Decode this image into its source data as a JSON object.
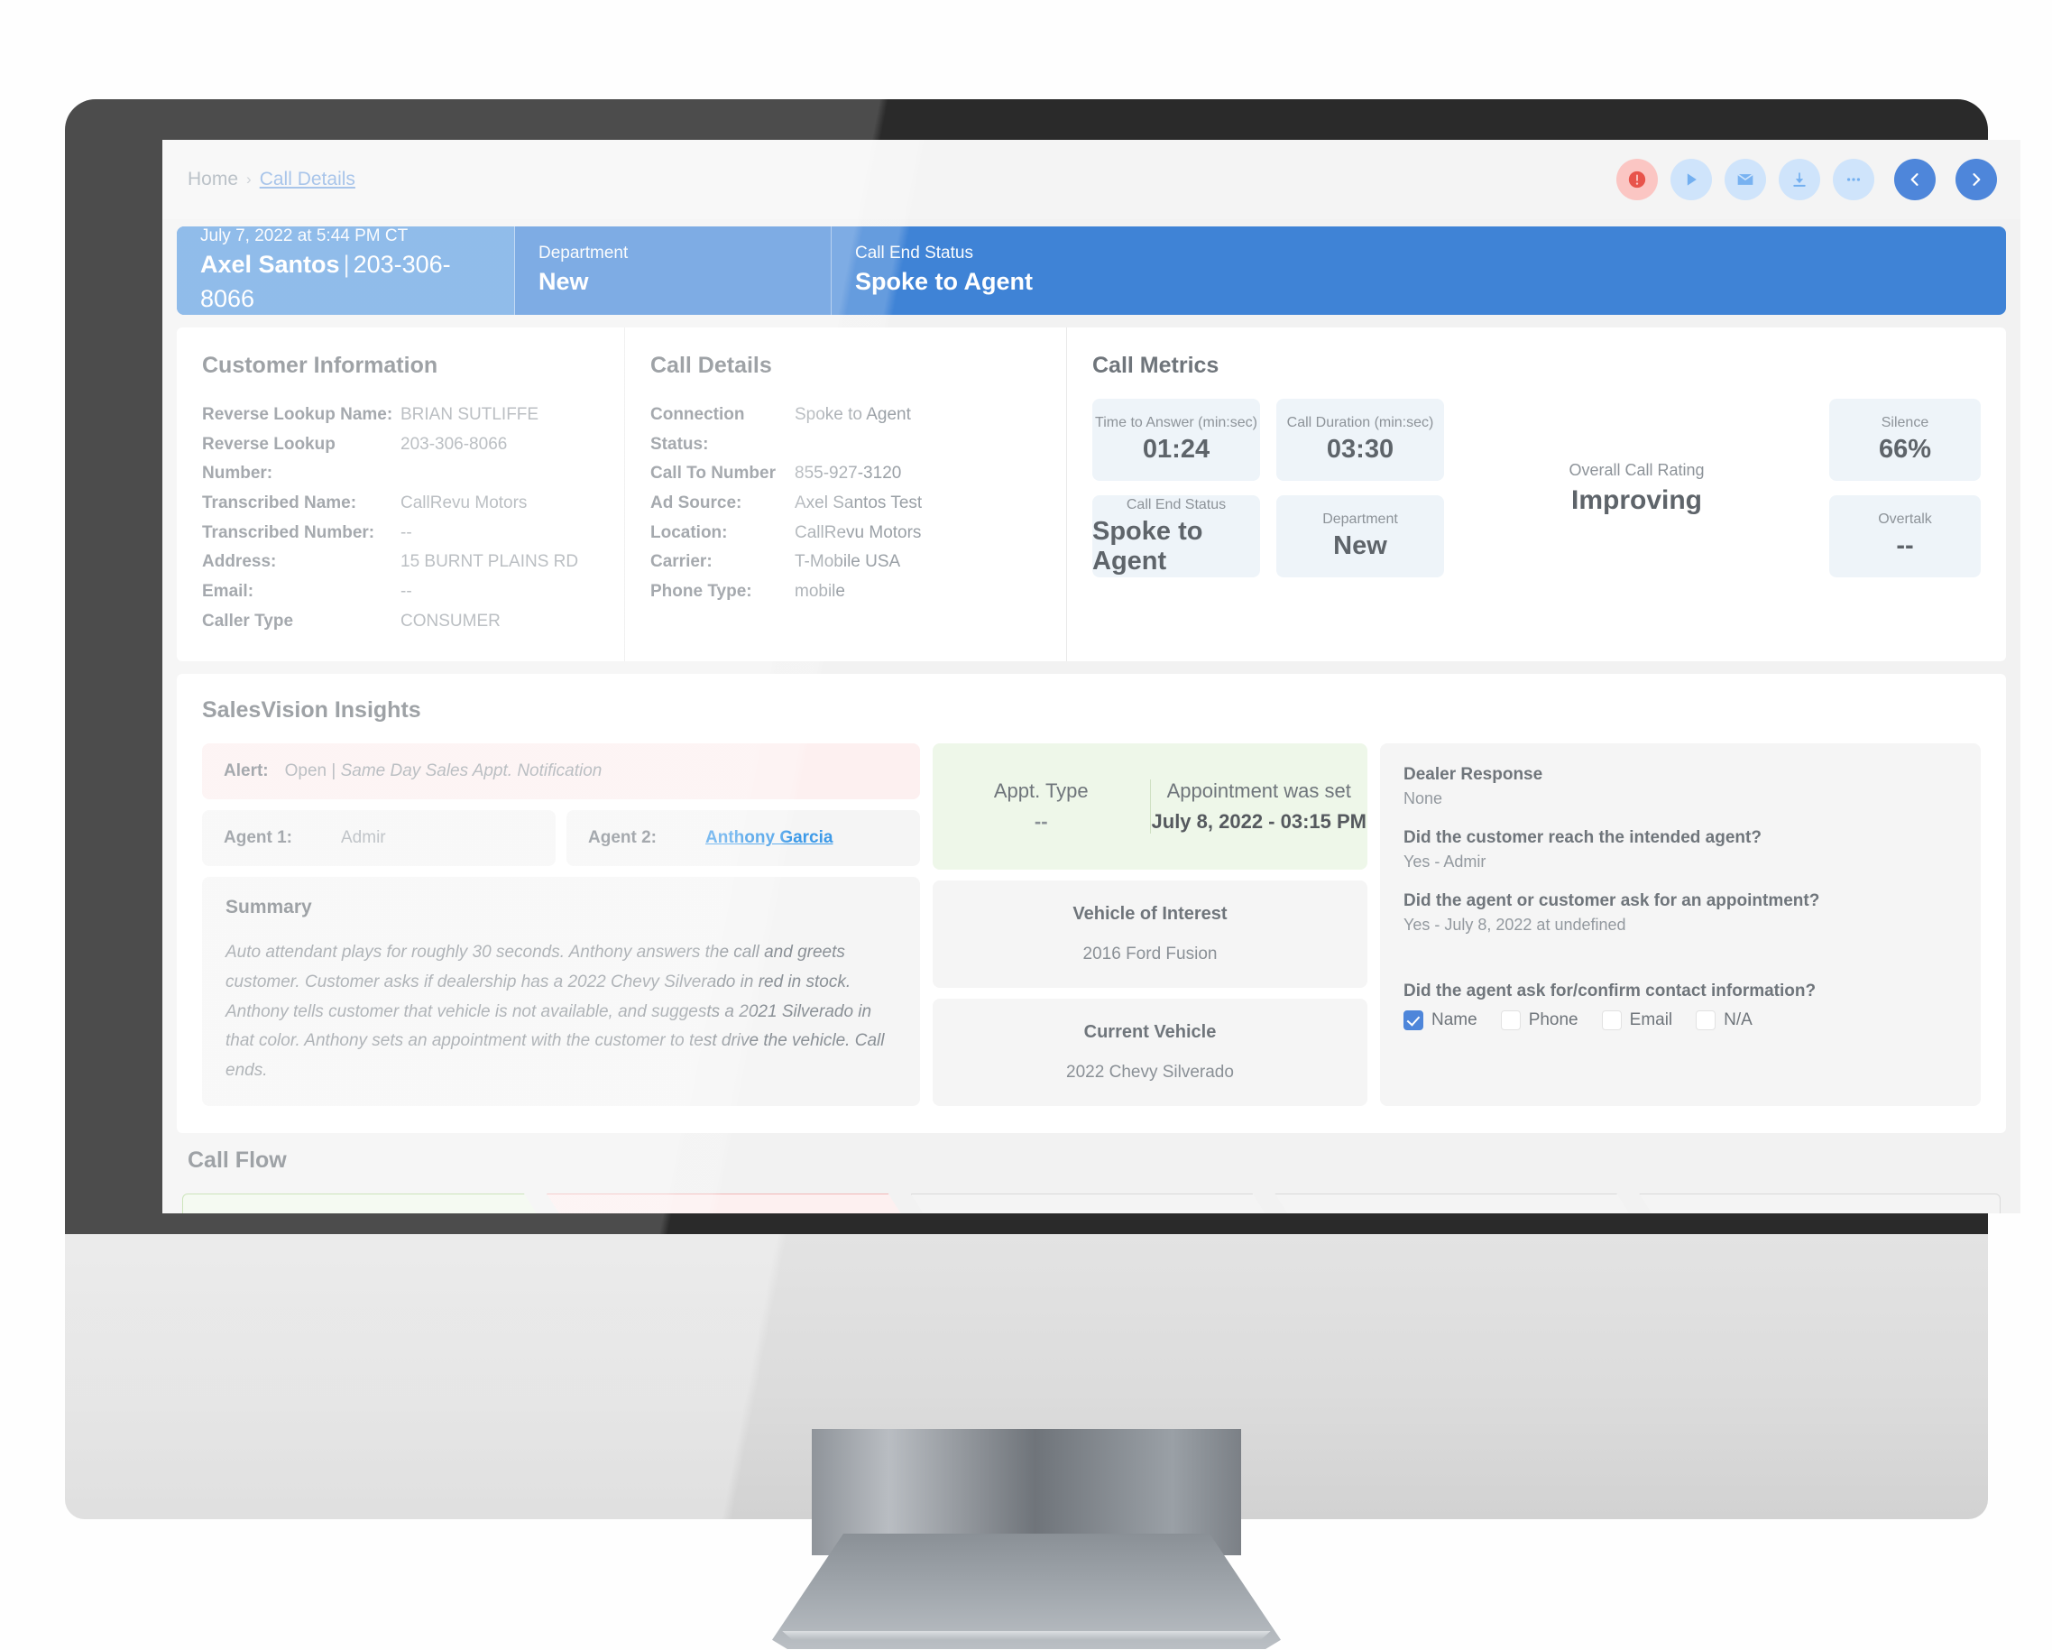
{
  "breadcrumb": {
    "home": "Home",
    "separator": "›",
    "current": "Call Details"
  },
  "toolbar": {
    "alert_label": "alert",
    "play_label": "play",
    "email_label": "email",
    "download_label": "download",
    "more_label": "more",
    "prev_label": "previous",
    "next_label": "next",
    "accent_blue": "#4e86da",
    "accent_light_blue": "#cfe4fb",
    "accent_red": "#fbc6c3"
  },
  "band": {
    "timestamp": "July 7, 2022 at 5:44 PM CT",
    "caller_name": "Axel Santos",
    "pipe": "|",
    "caller_number": "203-306-8066",
    "department_label": "Department",
    "department_value": "New",
    "call_end_status_label": "Call End Status",
    "call_end_status_value": "Spoke to Agent",
    "color": "#3f83d6"
  },
  "customer_information": {
    "title": "Customer Information",
    "rows": [
      {
        "key": "Reverse Lookup Name:",
        "value": "BRIAN SUTLIFFE"
      },
      {
        "key": "Reverse Lookup Number:",
        "value": "203-306-8066"
      },
      {
        "key": "Transcribed Name:",
        "value": "CallRevu Motors"
      },
      {
        "key": "Transcribed Number:",
        "value": "--"
      },
      {
        "key": "Address:",
        "value": "15 BURNT PLAINS RD"
      },
      {
        "key": "Email:",
        "value": "--"
      },
      {
        "key": "Caller Type",
        "value": "CONSUMER"
      }
    ]
  },
  "call_details": {
    "title": "Call Details",
    "rows": [
      {
        "key": "Connection Status:",
        "value": "Spoke to Agent"
      },
      {
        "key": "Call To Number",
        "value": "855-927-3120"
      },
      {
        "key": "Ad Source:",
        "value": "Axel Santos Test"
      },
      {
        "key": "Location:",
        "value": "CallRevu Motors"
      },
      {
        "key": "Carrier:",
        "value": "T-Mobile USA"
      },
      {
        "key": "Phone Type:",
        "value": "mobile"
      }
    ]
  },
  "call_metrics": {
    "title": "Call Metrics",
    "boxes": [
      {
        "label": "Time to Answer (min:sec)",
        "value": "01:24"
      },
      {
        "label": "Call Duration (min:sec)",
        "value": "03:30"
      },
      {
        "label": "Call End Status",
        "value": "Spoke to Agent"
      },
      {
        "label": "Department",
        "value": "New"
      },
      {
        "label": "Silence",
        "value": "66%"
      },
      {
        "label": "Overtalk",
        "value": "--"
      }
    ],
    "rating_label": "Overall Call Rating",
    "rating_value": "Improving"
  },
  "sales_vision": {
    "title": "SalesVision Insights",
    "alert_label": "Alert:",
    "alert_status": "Open | ",
    "alert_text": "Same Day Sales Appt. Notification",
    "agent1_label": "Agent 1:",
    "agent1_value": "Admir",
    "agent2_label": "Agent 2:",
    "agent2_value": "Anthony Garcia",
    "summary_title": "Summary",
    "summary_text": "Auto attendant plays for roughly 30 seconds.  Anthony answers the call and greets customer. Customer asks if dealership has a 2022 Chevy Silverado in red in stock.  Anthony tells customer that vehicle is not available, and suggests a 2021 Silverado in that color.  Anthony sets an appointment with the customer to test drive the vehicle.  Call ends.",
    "appt_type_label": "Appt. Type",
    "appt_type_value": "--",
    "appt_set_label": "Appointment was set",
    "appt_set_value": "July 8, 2022 - 03:15 PM",
    "vehicle_interest_title": "Vehicle of Interest",
    "vehicle_interest_value": "2016 Ford Fusion",
    "current_vehicle_title": "Current Vehicle",
    "current_vehicle_value": "2022 Chevy Silverado"
  },
  "dealer_response": {
    "title": "Dealer Response",
    "value": "None",
    "q1": "Did the customer reach the intended agent?",
    "a1": "Yes - Admir",
    "q2": "Did the agent or customer ask for an appointment?",
    "a2": "Yes - July 8, 2022 at undefined",
    "q3": "Did the agent ask for/confirm contact information?",
    "checkboxes": [
      {
        "label": "Name",
        "checked": true
      },
      {
        "label": "Phone",
        "checked": false
      },
      {
        "label": "Email",
        "checked": false
      },
      {
        "label": "N/A",
        "checked": false
      }
    ]
  },
  "call_flow": {
    "title": "Call Flow",
    "segments": [
      {
        "state": "green"
      },
      {
        "state": "red"
      },
      {
        "state": "neutral"
      },
      {
        "state": "neutral"
      },
      {
        "state": "neutral"
      }
    ]
  }
}
